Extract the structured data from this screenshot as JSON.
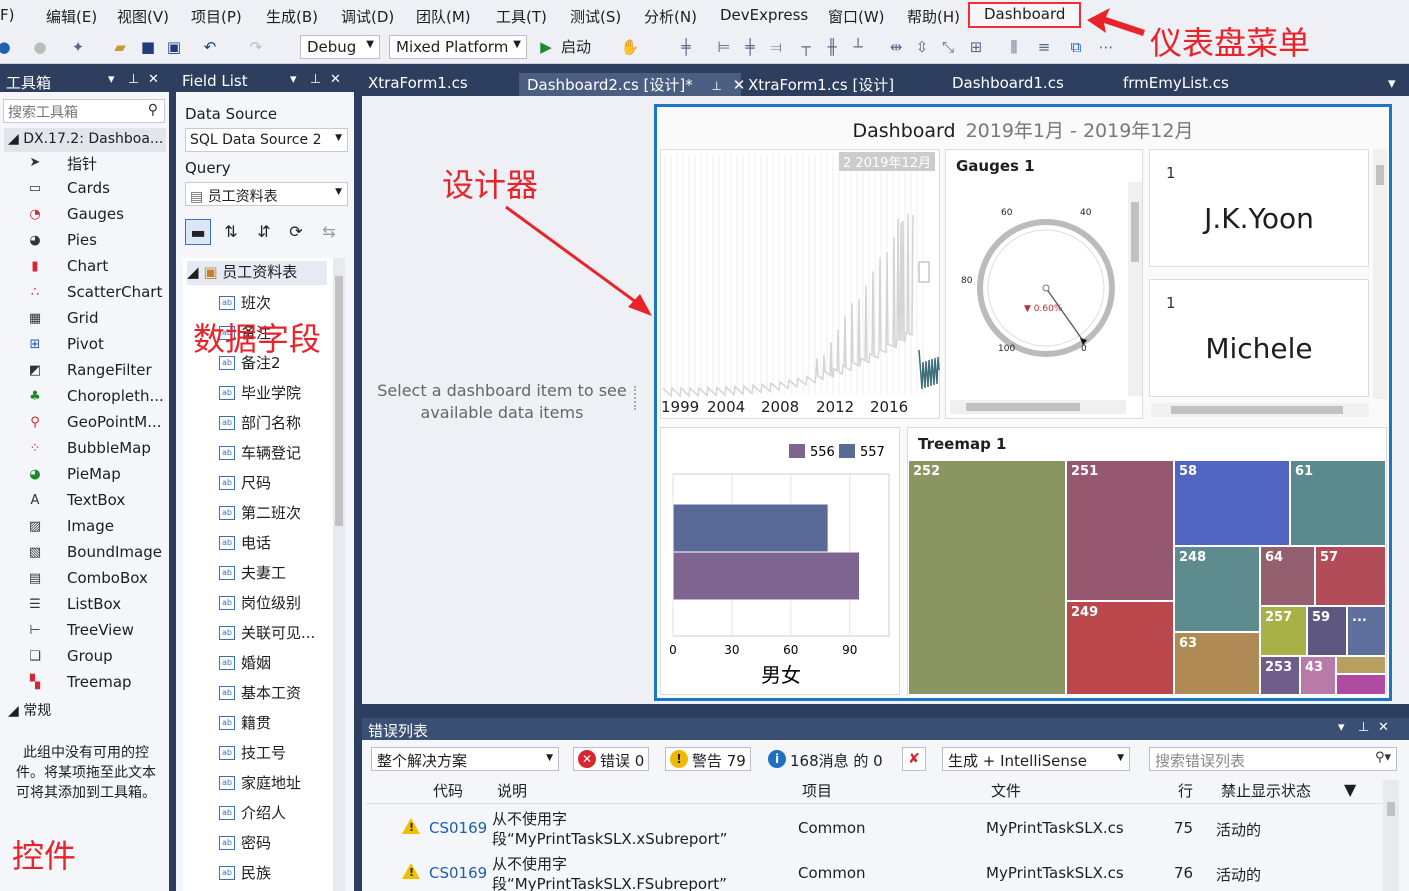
{
  "menu": [
    "F)",
    "编辑(E)",
    "视图(V)",
    "项目(P)",
    "生成(B)",
    "调试(D)",
    "团队(M)",
    "工具(T)",
    "测试(S)",
    "分析(N)",
    "DevExpress",
    "窗口(W)",
    "帮助(H)",
    "Dashboard"
  ],
  "toolbar": {
    "config": "Debug",
    "platform": "Mixed Platform",
    "start": "启动"
  },
  "toolbox": {
    "title": "工具箱",
    "search_placeholder": "搜索工具箱",
    "group": "DX.17.2: Dashboa...",
    "items": [
      {
        "label": "指针",
        "icon": "pointer-icon"
      },
      {
        "label": "Cards",
        "icon": "cards-icon"
      },
      {
        "label": "Gauges",
        "icon": "gauges-icon"
      },
      {
        "label": "Pies",
        "icon": "pies-icon"
      },
      {
        "label": "Chart",
        "icon": "chart-icon"
      },
      {
        "label": "ScatterChart",
        "icon": "scatter-icon"
      },
      {
        "label": "Grid",
        "icon": "grid-icon"
      },
      {
        "label": "Pivot",
        "icon": "pivot-icon"
      },
      {
        "label": "RangeFilter",
        "icon": "rangefilter-icon"
      },
      {
        "label": "Choropleth...",
        "icon": "choropleth-icon"
      },
      {
        "label": "GeoPointM...",
        "icon": "geopoint-icon"
      },
      {
        "label": "BubbleMap",
        "icon": "bubblemap-icon"
      },
      {
        "label": "PieMap",
        "icon": "piemap-icon"
      },
      {
        "label": "TextBox",
        "icon": "textbox-icon"
      },
      {
        "label": "Image",
        "icon": "image-icon"
      },
      {
        "label": "BoundImage",
        "icon": "boundimage-icon"
      },
      {
        "label": "ComboBox",
        "icon": "combobox-icon"
      },
      {
        "label": "ListBox",
        "icon": "listbox-icon"
      },
      {
        "label": "TreeView",
        "icon": "treeview-icon"
      },
      {
        "label": "Group",
        "icon": "group-icon"
      },
      {
        "label": "Treemap",
        "icon": "treemap-icon"
      }
    ],
    "general_group": "常规",
    "empty_text": "此组中没有可用的控件。将某项拖至此文本可将其添加到工具箱。"
  },
  "fieldlist": {
    "title": "Field List",
    "datasource_label": "Data Source",
    "datasource_value": "SQL Data Source 2",
    "query_label": "Query",
    "query_value": "员工资料表",
    "table": "员工资料表",
    "fields": [
      "班次",
      "备注",
      "备注2",
      "毕业学院",
      "部门名称",
      "车辆登记",
      "尺码",
      "第二班次",
      "电话",
      "夫妻工",
      "岗位级别",
      "关联可见...",
      "婚姻",
      "基本工资",
      "籍贯",
      "技工号",
      "家庭地址",
      "介绍人",
      "密码",
      "民族"
    ]
  },
  "tabs": [
    "XtraForm1.cs",
    "Dashboard2.cs [设计]*",
    "XtraForm1.cs [设计]",
    "Dashboard1.cs",
    "frmEmyList.cs"
  ],
  "designer": {
    "hint": "Select a dashboard item to see available data items",
    "dashboard": {
      "title": "Dashboard",
      "subtitle": "2019年1月 - 2019年12月",
      "range_badge": "2 2019年12月",
      "range_ticks": [
        "1999",
        "2004",
        "2008",
        "2012",
        "2016"
      ],
      "gauge_title": "Gauges 1",
      "gauge_ticks": [
        "60",
        "40",
        "80",
        "100",
        "0"
      ],
      "gauge_delta": "▼ 0.60%",
      "cards": [
        {
          "num": "1",
          "name": "J.K.Yoon"
        },
        {
          "num": "1",
          "name": "Michele"
        }
      ],
      "treemap_title": "Treemap 1"
    }
  },
  "chart_data": {
    "type": "bar",
    "orientation": "horizontal",
    "categories": [
      "男女"
    ],
    "xlabel": "男女",
    "xlim": [
      0,
      110
    ],
    "ticks": [
      "0",
      "30",
      "60",
      "90"
    ],
    "series": [
      {
        "name": "556",
        "values": [
          95
        ],
        "color": "#7d6590"
      },
      {
        "name": "557",
        "values": [
          79
        ],
        "color": "#5a6a97"
      }
    ]
  },
  "treemap": [
    {
      "label": "252",
      "color": "#8b9561"
    },
    {
      "label": "251",
      "color": "#96586e"
    },
    {
      "label": "249",
      "color": "#b9474c"
    },
    {
      "label": "58",
      "color": "#5066c2"
    },
    {
      "label": "61",
      "color": "#5b8a8e"
    },
    {
      "label": "248",
      "color": "#5d8b8e"
    },
    {
      "label": "64",
      "color": "#946070"
    },
    {
      "label": "57",
      "color": "#b24c58"
    },
    {
      "label": "63",
      "color": "#b08a55"
    },
    {
      "label": "257",
      "color": "#a8b048"
    },
    {
      "label": "59",
      "color": "#5e5780"
    },
    {
      "label": "...",
      "color": "#5e6f9e"
    },
    {
      "label": "253",
      "color": "#6f5c88"
    },
    {
      "label": "43",
      "color": "#b87aa8"
    },
    {
      "label": "",
      "color": "#b5a060"
    },
    {
      "label": "",
      "color": "#b04aa0"
    }
  ],
  "errorlist": {
    "title": "错误列表",
    "scope": "整个解决方案",
    "errors": "错误 0",
    "warnings": "警告 79",
    "messages": "168消息 的 0",
    "build": "生成 + IntelliSense",
    "search_placeholder": "搜索错误列表",
    "columns": [
      "代码",
      "说明",
      "项目",
      "文件",
      "行",
      "禁止显示状态"
    ],
    "rows": [
      {
        "code": "CS0169",
        "desc1": "从不使用字",
        "desc2": "段“MyPrintTaskSLX.xSubreport”",
        "project": "Common",
        "file": "MyPrintTaskSLX.cs",
        "line": "75",
        "state": "活动的"
      },
      {
        "code": "CS0169",
        "desc1": "从不使用字",
        "desc2": "段“MyPrintTaskSLX.FSubreport”",
        "project": "Common",
        "file": "MyPrintTaskSLX.cs",
        "line": "76",
        "state": "活动的"
      }
    ]
  },
  "annotations": {
    "menu": "仪表盘菜单",
    "designer": "设计器",
    "fields": "数据字段",
    "controls": "控件"
  }
}
